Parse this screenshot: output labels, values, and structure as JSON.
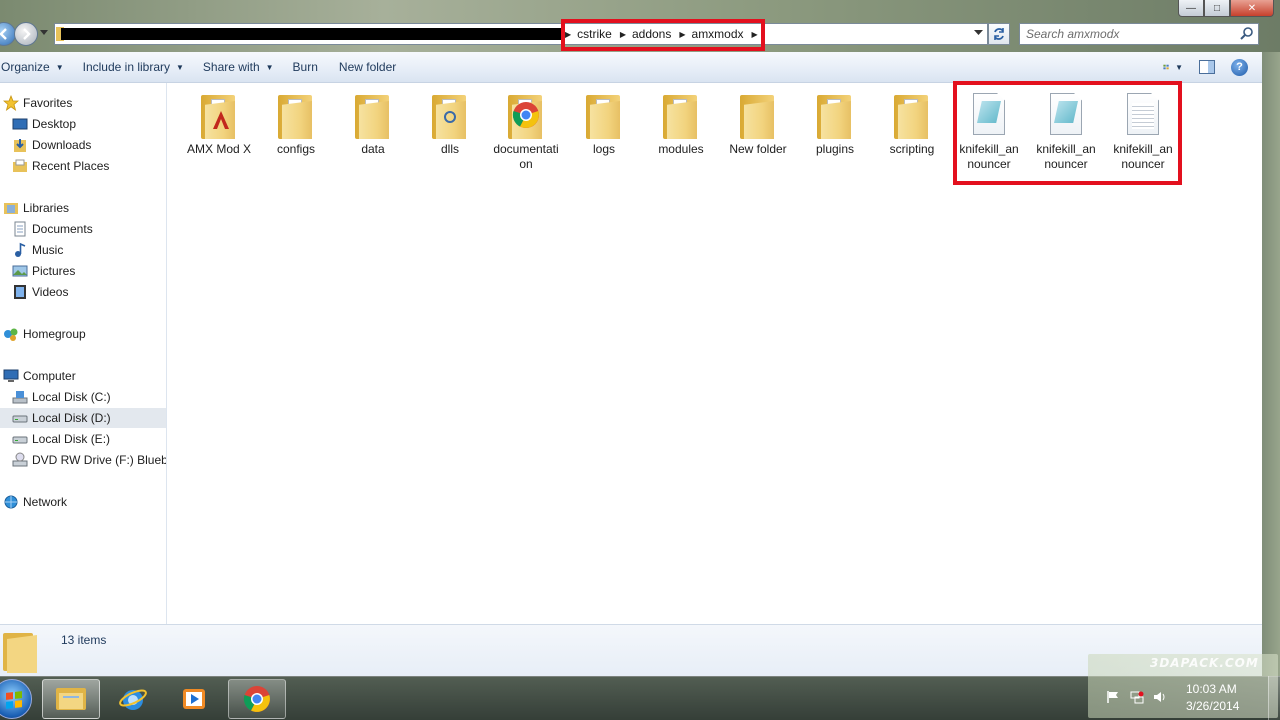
{
  "window": {
    "minimize_glyph": "—",
    "maximize_glyph": "□",
    "close_glyph": "✕"
  },
  "address": {
    "crumbs": [
      "cstrike",
      "addons",
      "amxmodx"
    ],
    "search_placeholder": "Search amxmodx"
  },
  "toolbar": {
    "organize": "Organize",
    "include_in_library": "Include in library",
    "share_with": "Share with",
    "burn": "Burn",
    "new_folder": "New folder"
  },
  "nav": {
    "favorites": "Favorites",
    "desktop": "Desktop",
    "downloads": "Downloads",
    "recent_places": "Recent Places",
    "libraries": "Libraries",
    "documents": "Documents",
    "music": "Music",
    "pictures": "Pictures",
    "videos": "Videos",
    "homegroup": "Homegroup",
    "computer": "Computer",
    "disk_c": "Local Disk (C:)",
    "disk_d": "Local Disk (D:)",
    "disk_e": "Local Disk (E:)",
    "dvd": "DVD RW Drive (F:) Bluebir",
    "network": "Network"
  },
  "files": [
    {
      "label": "AMX Mod X",
      "icon": "folder-shortcut-icon"
    },
    {
      "label": "configs",
      "icon": "folder-icon"
    },
    {
      "label": "data",
      "icon": "folder-icon"
    },
    {
      "label": "dlls",
      "icon": "folder-icon"
    },
    {
      "label": "documentation",
      "icon": "folder-chrome-icon"
    },
    {
      "label": "logs",
      "icon": "folder-icon"
    },
    {
      "label": "modules",
      "icon": "folder-icon"
    },
    {
      "label": "New folder",
      "icon": "folder-icon"
    },
    {
      "label": "plugins",
      "icon": "folder-icon"
    },
    {
      "label": "scripting",
      "icon": "folder-icon"
    },
    {
      "label": "knifekill_announcer",
      "icon": "amxx-file-icon"
    },
    {
      "label": "knifekill_announcer",
      "icon": "amxx-file-icon"
    },
    {
      "label": "knifekill_announcer",
      "icon": "text-file-icon"
    }
  ],
  "details": {
    "items_count": "13 items"
  },
  "clock": {
    "time": "10:03 AM",
    "date": "3/26/2014"
  },
  "watermark": "3DAPACK.COM",
  "colors": {
    "highlight": "#e3101e",
    "folder": "#f2d47f",
    "toolbar_text": "#1e395b"
  }
}
